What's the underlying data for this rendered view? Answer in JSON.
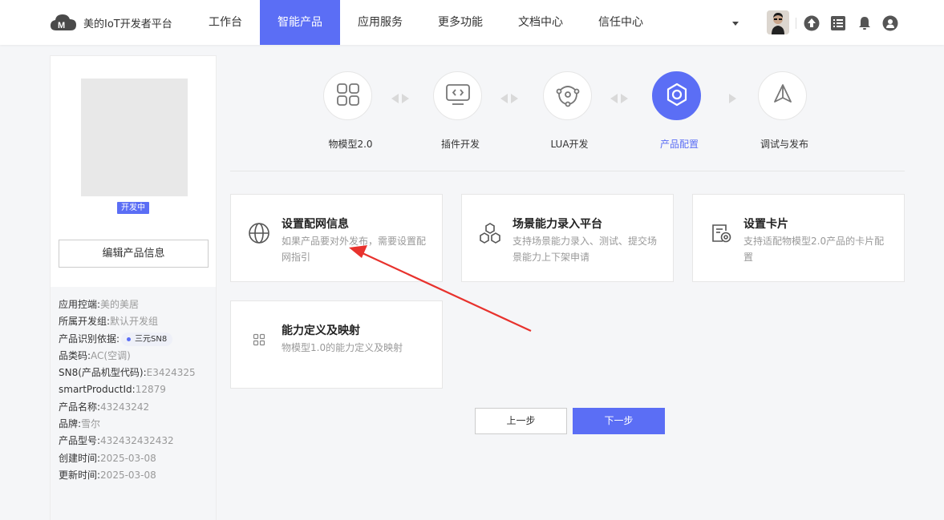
{
  "header": {
    "logo_text": "美的IoT开发者平台",
    "nav": [
      {
        "label": "工作台",
        "active": false
      },
      {
        "label": "智能产品",
        "active": true
      },
      {
        "label": "应用服务",
        "active": false
      },
      {
        "label": "更多功能",
        "active": false
      },
      {
        "label": "文档中心",
        "active": false
      },
      {
        "label": "信任中心",
        "active": false
      }
    ],
    "icons": [
      "upload-icon",
      "list-icon",
      "bell-icon",
      "user-icon"
    ]
  },
  "product": {
    "status": "开发中",
    "edit_button": "编辑产品信息",
    "info": [
      {
        "label": "应用控端: ",
        "value": "美的美居"
      },
      {
        "label": "所属开发组: ",
        "value": "默认开发组"
      },
      {
        "label": "产品识别依据: ",
        "tag": "三元SN8"
      },
      {
        "label": "品类码: ",
        "value": "AC(空调)"
      },
      {
        "label": "SN8(产品机型代码): ",
        "value": "E3424325"
      },
      {
        "label": "smartProductId: ",
        "value": "12879"
      },
      {
        "label": "产品名称: ",
        "value": "43243242"
      },
      {
        "label": "品牌: ",
        "value": "雪尔"
      },
      {
        "label": "产品型号: ",
        "value": "432432432432"
      },
      {
        "label": "创建时间: ",
        "value": "2025-03-08"
      },
      {
        "label": "更新时间: ",
        "value": "2025-03-08"
      }
    ]
  },
  "steps": [
    {
      "label": "物模型2.0",
      "icon": "grid-icon",
      "active": false
    },
    {
      "label": "插件开发",
      "icon": "code-monitor-icon",
      "active": false
    },
    {
      "label": "LUA开发",
      "icon": "network-icon",
      "active": false
    },
    {
      "label": "产品配置",
      "icon": "gear-icon",
      "active": true
    },
    {
      "label": "调试与发布",
      "icon": "send-icon",
      "active": false
    }
  ],
  "cards": [
    {
      "title": "设置配网信息",
      "desc": "如果产品要对外发布，需要设置配网指引",
      "icon": "globe-icon"
    },
    {
      "title": "场景能力录入平台",
      "desc": "支持场景能力录入、测试、提交场景能力上下架申请",
      "icon": "hexagons-icon"
    },
    {
      "title": "设置卡片",
      "desc": "支持适配物模型2.0产品的卡片配置",
      "icon": "card-settings-icon"
    },
    {
      "title": "能力定义及映射",
      "desc": "物模型1.0的能力定义及映射",
      "icon": "small-grid-icon"
    }
  ],
  "buttons": {
    "prev": "上一步",
    "next": "下一步"
  },
  "colors": {
    "accent": "#5b6ef5",
    "annotation": "#e8322d"
  }
}
